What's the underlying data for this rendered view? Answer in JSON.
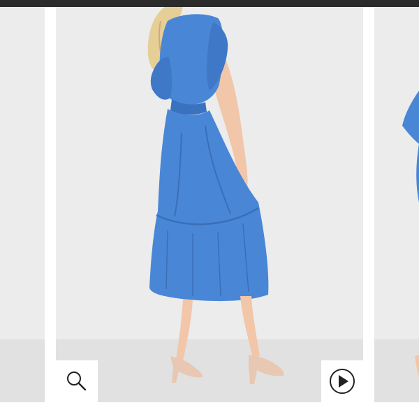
{
  "gallery": {
    "accent_color": "#4a86d6",
    "background_color": "#ececec",
    "floor_color": "#e1e1e1",
    "slides": [
      {
        "name": "previous-slide"
      },
      {
        "name": "current-slide"
      },
      {
        "name": "next-slide"
      }
    ]
  },
  "controls": {
    "zoom_icon": "magnifier-icon",
    "video_icon": "play-circle-icon"
  }
}
